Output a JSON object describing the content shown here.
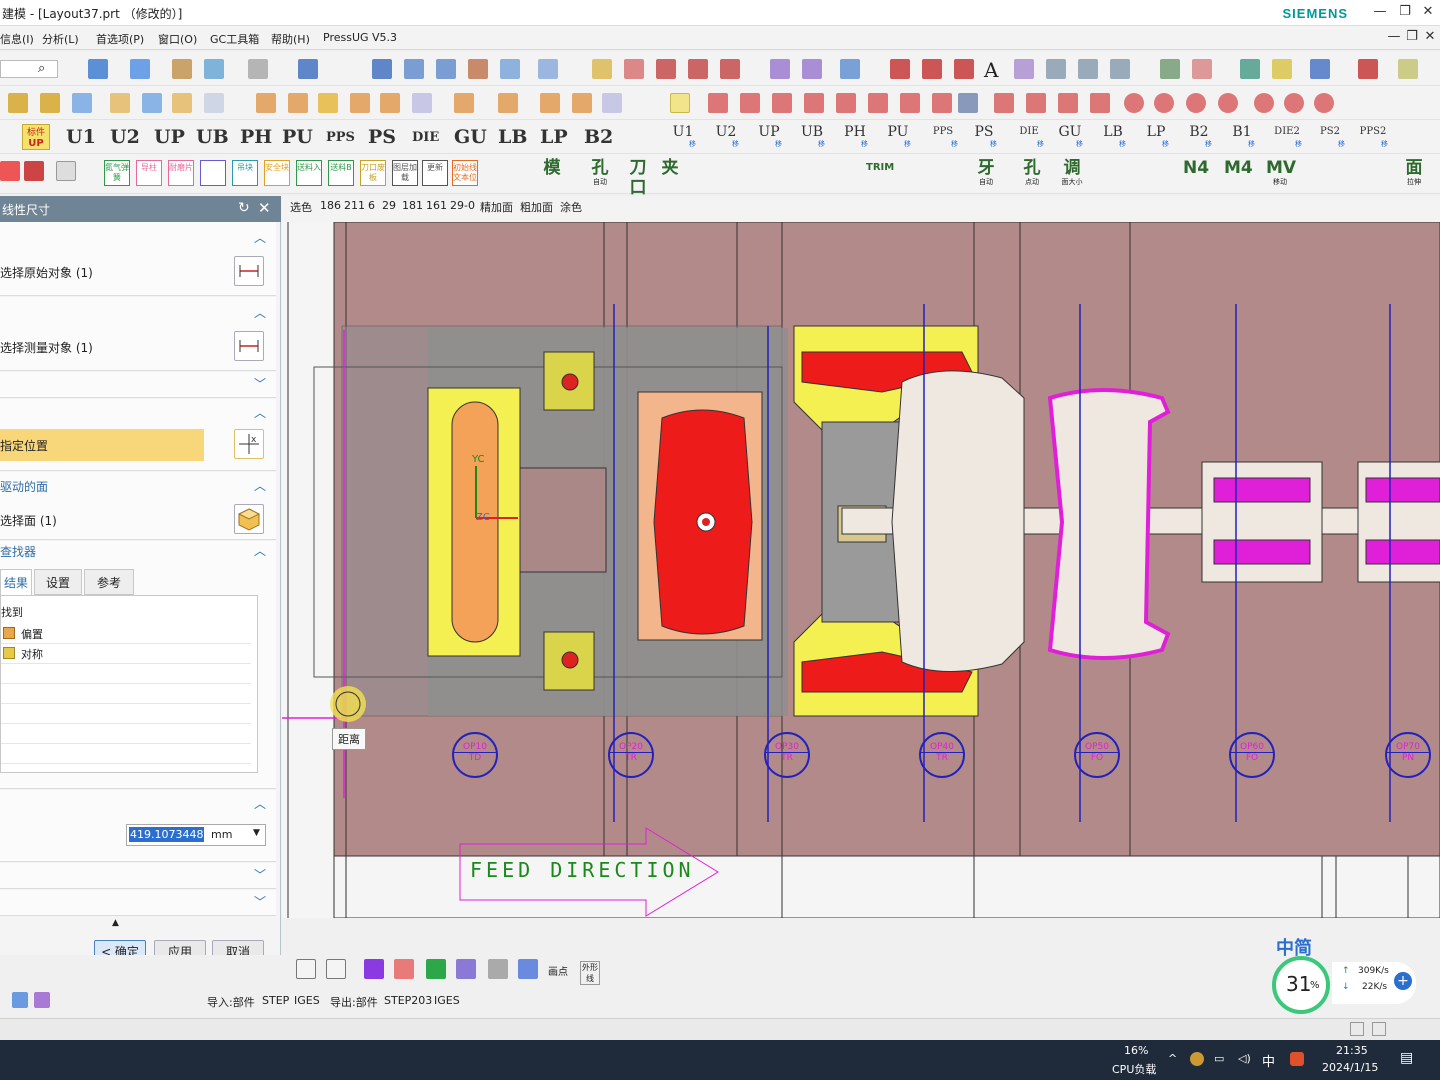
{
  "window": {
    "title": "建模 - [Layout37.prt （修改的）]",
    "brand": "SIEMENS"
  },
  "menu": {
    "items": [
      "信息(I)",
      "分析(L)",
      "首选项(P)",
      "窗口(O)",
      "GC工具箱",
      "帮助(H)",
      "PressUG V5.3"
    ]
  },
  "toolbar_row3": {
    "labels": [
      "U1",
      "U2",
      "UP",
      "UB",
      "PH",
      "PU",
      "PPS",
      "PS",
      "DIE",
      "GU",
      "LB",
      "LP",
      "B2"
    ],
    "labels_right": [
      "U1",
      "U2",
      "UP",
      "UB",
      "PH",
      "PU",
      "PPS",
      "PS",
      "DIE",
      "GU",
      "LB",
      "LP",
      "B2",
      "B1",
      "DIE2",
      "PS2",
      "PPS2"
    ],
    "sublabel": "移",
    "upper_badge": "标件",
    "upper_badge_sub": "UP"
  },
  "toolbar_row4": {
    "labels": [
      "氮气弹簧",
      "导柱",
      "耐磨片",
      "",
      "吊块",
      "安全块",
      "送料入",
      "送料B",
      "刀口废板",
      "图层加载",
      "更新",
      "初始线文本位"
    ],
    "labels_right": [
      "模",
      "孔",
      "刀口",
      "夹",
      "TRIM",
      "牙",
      "孔",
      "调",
      "N4",
      "M4",
      "MV",
      "面"
    ],
    "labels_right_sub": [
      "",
      "自动",
      "",
      "",
      "",
      "自动",
      "点动",
      "面大小",
      "",
      "",
      "移动",
      "拉伸"
    ]
  },
  "selection_bar": {
    "items": [
      "选色",
      "186",
      "211",
      "6",
      "29",
      "181",
      "161",
      "29-0",
      "精加面",
      "粗加面",
      "涂色"
    ]
  },
  "panel": {
    "title": "线性尺寸",
    "sections": {
      "origin": {
        "label": "选择原始对象 (1)"
      },
      "measure": {
        "label": "选择测量对象 (1)"
      },
      "locate": {
        "label": "指定位置"
      },
      "driven_face": {
        "title": "驱动的面",
        "label": "选择面 (1)"
      },
      "finder": {
        "title": "查找器"
      }
    },
    "tabs": [
      "结果",
      "设置",
      "参考"
    ],
    "result_header": "找到",
    "results": [
      {
        "icon": "offset-icon",
        "label": "偏置"
      },
      {
        "icon": "symmetry-icon",
        "label": "对称"
      }
    ],
    "distance_value": "419.1073448",
    "distance_unit": "mm",
    "buttons": {
      "ok": "< 确定 >",
      "apply": "应用",
      "cancel": "取消"
    }
  },
  "canvas": {
    "tooltip": "距离",
    "feed_text": "FEED DIRECTION",
    "axis_labels": {
      "yc": "YC",
      "zc": "ZC"
    },
    "stations": [
      "OP10",
      "OP20",
      "OP30",
      "OP40",
      "OP50",
      "OP60",
      "OP70"
    ],
    "station_sub": [
      "TD",
      "TR",
      "TR",
      "TR",
      "FO",
      "FO",
      "PN"
    ]
  },
  "bottom_toolbar": {
    "label1": "画点",
    "label2": "外形线",
    "import_label": "导入:部件",
    "import_fmt1": "STEP",
    "import_fmt2": "IGES",
    "export_label": "导出:部件",
    "export_fmt1": "STEP203",
    "export_fmt2": "IGES"
  },
  "network_widget": {
    "cpu_percent": "31",
    "percent_sign": "%",
    "up_speed": "309K/s",
    "down_speed": "22K/s",
    "brand": "中简"
  },
  "taskbar": {
    "cpu_label": "CPU负载",
    "cpu_value": "16%",
    "ime": "中",
    "time": "21:35",
    "date": "2024/1/15"
  },
  "colors": {
    "panel_header": "#6f8494",
    "highlight": "#f8d77a",
    "canvas_bg": "#b08a8a",
    "yellow_part": "#f4f051",
    "red_part": "#ee1b1b",
    "magenta_part": "#e020d8",
    "station_blue": "#2222bb"
  }
}
